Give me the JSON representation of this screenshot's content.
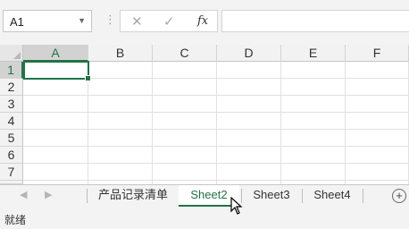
{
  "formula_bar": {
    "name_box": "A1",
    "cancel_icon": "✕",
    "enter_icon": "✓",
    "fx_label": "fx",
    "formula": ""
  },
  "columns": [
    "A",
    "B",
    "C",
    "D",
    "E",
    "F"
  ],
  "rows": [
    "1",
    "2",
    "3",
    "4",
    "5",
    "6",
    "7"
  ],
  "selected_cell": "A1",
  "sheet_tabs": [
    "产品记录清单",
    "Sheet2",
    "Sheet3",
    "Sheet4"
  ],
  "active_sheet": "Sheet2",
  "add_sheet_icon": "+",
  "status": "就绪",
  "colors": {
    "accent": "#217346"
  }
}
